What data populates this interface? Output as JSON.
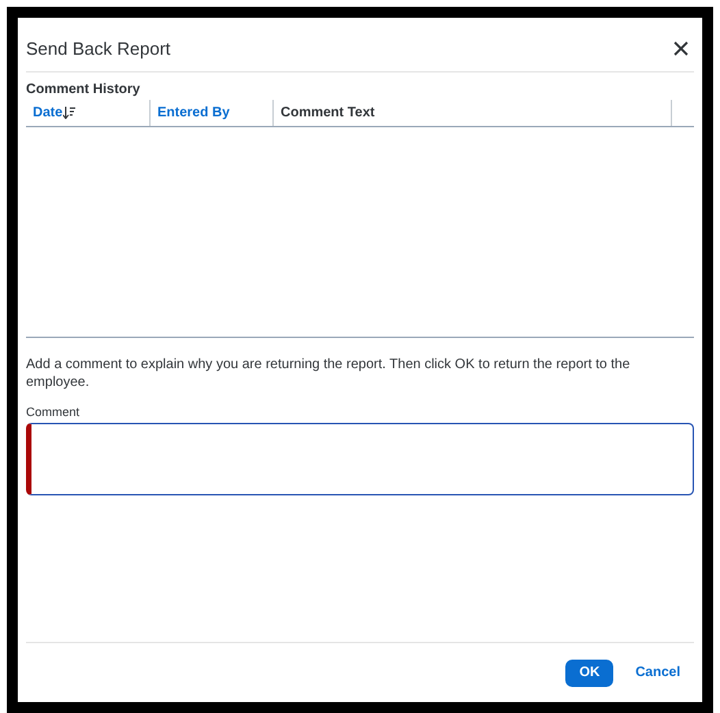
{
  "dialog": {
    "title": "Send Back Report"
  },
  "comment_history": {
    "title": "Comment History",
    "columns": [
      {
        "label": "Date",
        "sortable": true,
        "sorted": true
      },
      {
        "label": "Entered By",
        "sortable": true,
        "sorted": false
      },
      {
        "label": "Comment Text",
        "sortable": false,
        "sorted": false
      }
    ]
  },
  "instructions": "Add a comment to explain why you are returning the report. Then click OK to return the report to the employee.",
  "comment_field": {
    "label": "Comment",
    "required": true,
    "focused": true
  },
  "buttons": [
    {
      "label": "OK",
      "kind": "primary"
    },
    {
      "label": "Cancel",
      "kind": "link"
    }
  ]
}
